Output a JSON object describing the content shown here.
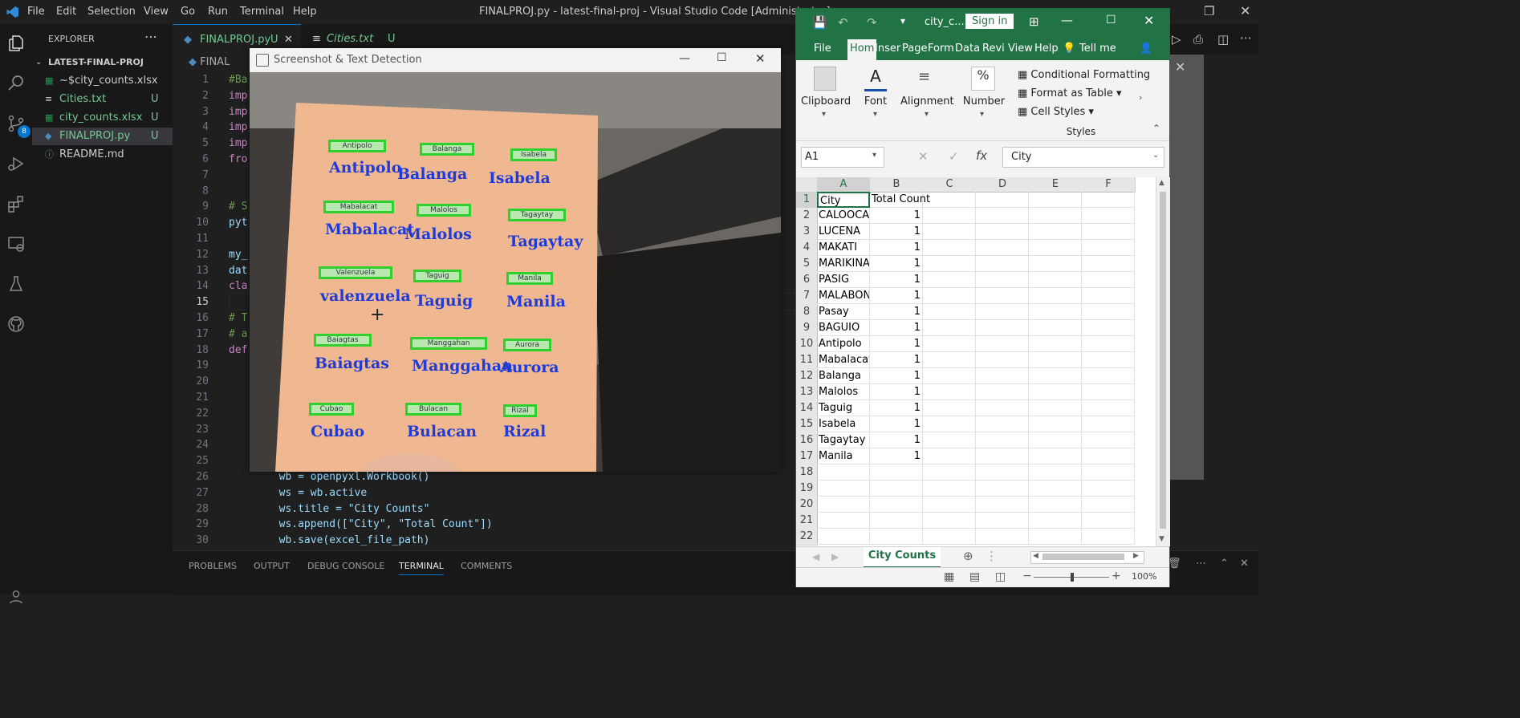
{
  "vscode": {
    "title": "FINALPROJ.py - latest-final-proj - Visual Studio Code [Administrator]",
    "menu": [
      "File",
      "Edit",
      "Selection",
      "View",
      "Go",
      "Run",
      "Terminal",
      "Help"
    ],
    "explorer_title": "EXPLORER",
    "folder": "LATEST-FINAL-PROJ",
    "files": [
      {
        "name": "~$city_counts.xlsx",
        "status": ""
      },
      {
        "name": "Cities.txt",
        "status": "U"
      },
      {
        "name": "city_counts.xlsx",
        "status": "U"
      },
      {
        "name": "FINALPROJ.py",
        "status": "U"
      },
      {
        "name": "README.md",
        "status": ""
      }
    ],
    "scm_badge": "8",
    "tabs": [
      {
        "name": "FINALPROJ.py",
        "status": "U"
      },
      {
        "name": "Cities.txt",
        "status": "U"
      }
    ],
    "breadcrumb": "FINAL",
    "code_lines": [
      {
        "n": "1",
        "t": "#Ba"
      },
      {
        "n": "2",
        "t": "imp"
      },
      {
        "n": "3",
        "t": "imp"
      },
      {
        "n": "4",
        "t": "imp"
      },
      {
        "n": "5",
        "t": "imp"
      },
      {
        "n": "6",
        "t": "fro"
      },
      {
        "n": "7",
        "t": ""
      },
      {
        "n": "8",
        "t": ""
      },
      {
        "n": "9",
        "t": "# S"
      },
      {
        "n": "10",
        "t": "pyt"
      },
      {
        "n": "11",
        "t": ""
      },
      {
        "n": "12",
        "t": "my_"
      },
      {
        "n": "13",
        "t": "dat"
      },
      {
        "n": "14",
        "t": "cla"
      },
      {
        "n": "15",
        "t": ""
      },
      {
        "n": "16",
        "t": "# T"
      },
      {
        "n": "17",
        "t": "# a"
      },
      {
        "n": "18",
        "t": "def"
      },
      {
        "n": "19",
        "t": ""
      },
      {
        "n": "20",
        "t": ""
      },
      {
        "n": "21",
        "t": ""
      },
      {
        "n": "22",
        "t": ""
      },
      {
        "n": "23",
        "t": ""
      },
      {
        "n": "24",
        "t": ""
      },
      {
        "n": "25",
        "t": ""
      },
      {
        "n": "26",
        "t": "        wb = openpyxl.Workbook()"
      },
      {
        "n": "27",
        "t": "        ws = wb.active"
      },
      {
        "n": "28",
        "t": "        ws.title = \"City Counts\""
      },
      {
        "n": "29",
        "t": "        ws.append([\"City\", \"Total Count\"])"
      },
      {
        "n": "30",
        "t": "        wb.save(excel_file_path)"
      }
    ],
    "panel_tabs": [
      "PROBLEMS",
      "OUTPUT",
      "DEBUG CONSOLE",
      "TERMINAL",
      "COMMENTS"
    ]
  },
  "screenshot_window": {
    "title": "Screenshot & Text Detection",
    "cities": [
      "Antipolo",
      "Balanga",
      "Isabela",
      "Mabalacat",
      "Malolos",
      "Tagaytay",
      "valenzuela",
      "Taguig",
      "Manila",
      "Baiagtas",
      "Manggahan",
      "Aurora",
      "Cubao",
      "Bulacan",
      "Rizal"
    ],
    "detections": [
      "Antipolo",
      "Balanga",
      "Isabela",
      "Mabalacat",
      "Malolos",
      "Tagaytay",
      "Valenzuela",
      "Taguig",
      "Manila",
      "Baiagtas",
      "Manggahan",
      "Aurora",
      "Cubao",
      "Bulacan",
      "Rizal"
    ]
  },
  "excel": {
    "title": "city_c...",
    "sign_in": "Sign in",
    "ribbon_tabs": [
      "File",
      "Hom",
      "Inser",
      "Page",
      "Form",
      "Data",
      "Revi",
      "View",
      "Help",
      "Tell me"
    ],
    "groups": {
      "clipboard": "Clipboard",
      "font": "Font",
      "alignment": "Alignment",
      "number": "Number",
      "styles": "Styles"
    },
    "styles_items": [
      "Conditional Formatting",
      "Format as Table",
      "Cell Styles"
    ],
    "name_box": "A1",
    "formula_value": "City",
    "columns": [
      "A",
      "B",
      "C",
      "D",
      "E",
      "F"
    ],
    "rows": [
      {
        "n": "1",
        "a": "City",
        "b": "Total Count"
      },
      {
        "n": "2",
        "a": "CALOOCAN",
        "b": "1"
      },
      {
        "n": "3",
        "a": "LUCENA",
        "b": "1"
      },
      {
        "n": "4",
        "a": "MAKATI",
        "b": "1"
      },
      {
        "n": "5",
        "a": "MARIKINA",
        "b": "1"
      },
      {
        "n": "6",
        "a": "PASIG",
        "b": "1"
      },
      {
        "n": "7",
        "a": "MALABON",
        "b": "1"
      },
      {
        "n": "8",
        "a": "Pasay",
        "b": "1"
      },
      {
        "n": "9",
        "a": "BAGUIO",
        "b": "1"
      },
      {
        "n": "10",
        "a": "Antipolo",
        "b": "1"
      },
      {
        "n": "11",
        "a": "Mabalacat",
        "b": "1"
      },
      {
        "n": "12",
        "a": "Balanga",
        "b": "1"
      },
      {
        "n": "13",
        "a": "Malolos",
        "b": "1"
      },
      {
        "n": "14",
        "a": "Taguig",
        "b": "1"
      },
      {
        "n": "15",
        "a": "Isabela",
        "b": "1"
      },
      {
        "n": "16",
        "a": "Tagaytay",
        "b": "1"
      },
      {
        "n": "17",
        "a": "Manila",
        "b": "1"
      },
      {
        "n": "18",
        "a": "",
        "b": ""
      },
      {
        "n": "19",
        "a": "",
        "b": ""
      },
      {
        "n": "20",
        "a": "",
        "b": ""
      },
      {
        "n": "21",
        "a": "",
        "b": ""
      },
      {
        "n": "22",
        "a": "",
        "b": ""
      }
    ],
    "sheet_tab": "City Counts",
    "zoom": "100%"
  }
}
